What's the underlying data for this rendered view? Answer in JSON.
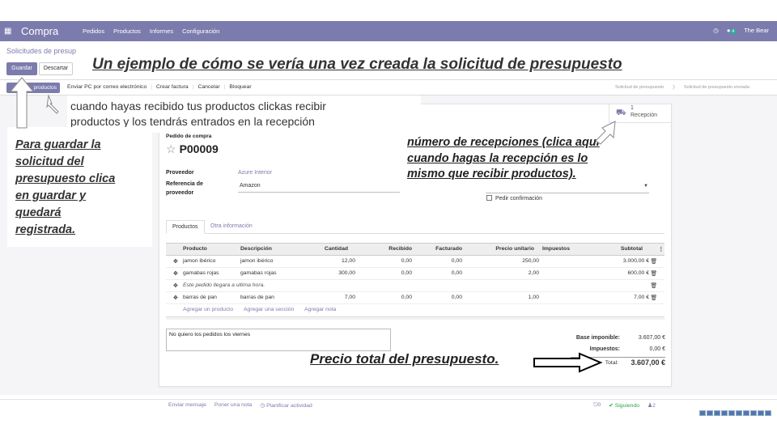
{
  "navbar": {
    "app_name": "Compra",
    "menu": [
      "Pedidos",
      "Productos",
      "Informes",
      "Configuración"
    ],
    "chat_count": "4",
    "company": "The Bear"
  },
  "breadcrumb": "Solicitudes de presup",
  "buttons": {
    "save": "Guardar",
    "discard": "Descartar",
    "receive": "productos"
  },
  "actions": [
    "Enviar PC por correo electrónico",
    "Crear factura",
    "Cancelar",
    "Bloquear"
  ],
  "statusbar": [
    "Solicitud de presupuesto",
    "Solicitud de presupuesto enviada"
  ],
  "receptions": {
    "count": "1",
    "label": "Recepción"
  },
  "order": {
    "label": "Pedido de compra",
    "name": "P00009",
    "vendor_label": "Proveedor",
    "vendor": "Azure Interior",
    "ref_label_1": "Referencia de",
    "ref_label_2": "proveedor",
    "ref": "Amazon",
    "confirm_label": "Pedir confirmación"
  },
  "tabs": [
    "Productos",
    "Otra información"
  ],
  "lines": {
    "headers": [
      "Producto",
      "Descripción",
      "Cantidad",
      "Recibido",
      "Facturado",
      "Precio unitario",
      "Impuestos",
      "Subtotal"
    ],
    "rows": [
      {
        "product": "jamon ibérico",
        "desc": "jamon ibérico",
        "qty": "12,00",
        "received": "0,00",
        "invoiced": "0,00",
        "price": "250,00",
        "subtotal": "3.000,00 €"
      },
      {
        "product": "gamabas rojas",
        "desc": "gamabas rojas",
        "qty": "300,00",
        "received": "0,00",
        "invoiced": "0,00",
        "price": "2,00",
        "subtotal": "600,00 €"
      },
      {
        "note": "Este pedido llegara a ultima hora."
      },
      {
        "product": "barras de pan",
        "desc": "barras de pan",
        "qty": "7,00",
        "received": "0,00",
        "invoiced": "0,00",
        "price": "1,00",
        "subtotal": "7,00 €"
      }
    ],
    "add_product": "Agregar un producto",
    "add_section": "Agregar una sección",
    "add_note": "Agregar nota"
  },
  "notes": "No quiero los pedidos los viernes",
  "totals": {
    "base_label": "Base imponible:",
    "base": "3.607,00 €",
    "tax_label": "Impuestos:",
    "tax": "0,00 €",
    "total_label": "Total:",
    "total": "3.607,00 €"
  },
  "chatter": {
    "send": "Enviar mensaje",
    "log": "Poner una nota",
    "activity": "Planificar actividad",
    "attachments": "0",
    "following": "Siguiendo",
    "followers": "2"
  },
  "annotations": {
    "title": "Un ejemplo de cómo se vería una vez creada la solicitud de presupuesto",
    "receive_line1": "cuando hayas recibido tus productos clickas recibir",
    "receive_line2": "productos y los tendrás entrados en la recepción",
    "save_lines": [
      "Para guardar  la",
      "solicitud  del",
      "presupuesto  clica",
      "en guardar  y",
      "quedará",
      "registrada."
    ],
    "receptions_lines": [
      "número de recepciones  (clica aquí",
      "cuando hagas la recepción  es lo",
      "mismo que recibir productos)."
    ],
    "total": "Precio total del presupuesto."
  },
  "colors": {
    "brand": "#7c7bad",
    "follow": "#28a745"
  }
}
